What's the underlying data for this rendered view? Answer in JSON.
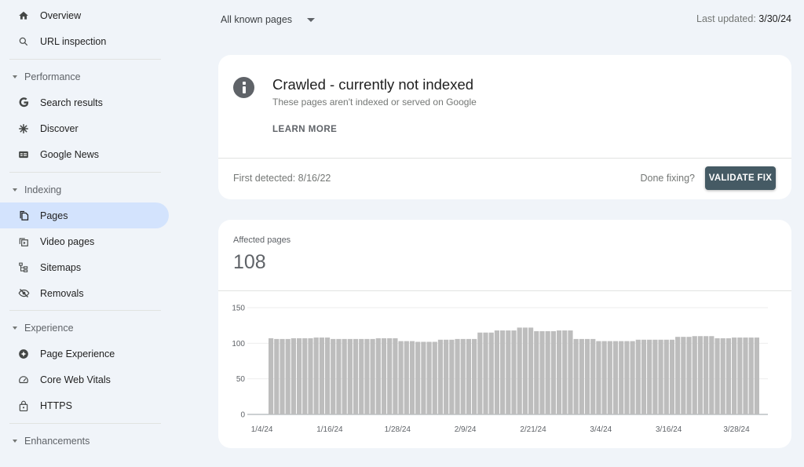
{
  "sidebar": {
    "top_items": [
      {
        "label": "Overview",
        "icon": "home-icon"
      },
      {
        "label": "URL inspection",
        "icon": "search-icon"
      }
    ],
    "sections": [
      {
        "title": "Performance",
        "items": [
          {
            "label": "Search results",
            "icon": "google-g-icon"
          },
          {
            "label": "Discover",
            "icon": "asterisk-icon"
          },
          {
            "label": "Google News",
            "icon": "news-icon"
          }
        ]
      },
      {
        "title": "Indexing",
        "items": [
          {
            "label": "Pages",
            "icon": "pages-icon",
            "active": true
          },
          {
            "label": "Video pages",
            "icon": "video-pages-icon"
          },
          {
            "label": "Sitemaps",
            "icon": "sitemap-icon"
          },
          {
            "label": "Removals",
            "icon": "eye-off-icon"
          }
        ]
      },
      {
        "title": "Experience",
        "items": [
          {
            "label": "Page Experience",
            "icon": "page-experience-icon"
          },
          {
            "label": "Core Web Vitals",
            "icon": "gauge-icon"
          },
          {
            "label": "HTTPS",
            "icon": "lock-icon"
          }
        ]
      },
      {
        "title": "Enhancements",
        "items": []
      }
    ]
  },
  "header": {
    "filter_value": "All known pages",
    "last_updated_label": "Last updated:",
    "last_updated_value": "3/30/24"
  },
  "issue": {
    "title": "Crawled - currently not indexed",
    "subtitle": "These pages aren't indexed or served on Google",
    "learn_more": "LEARN MORE",
    "first_detected": "First detected: 8/16/22",
    "done_fixing": "Done fixing?",
    "validate_label": "VALIDATE FIX",
    "icon_color": "#5f6368",
    "button_color": "#455a64"
  },
  "affected": {
    "label": "Affected pages",
    "value": "108"
  },
  "chart_data": {
    "type": "bar",
    "title": "",
    "xlabel": "",
    "ylabel": "",
    "ylim": [
      0,
      150
    ],
    "yticks": [
      0,
      50,
      100,
      150
    ],
    "grid": true,
    "bar_color": "#bdbdbd",
    "xtick_labels": [
      "1/4/24",
      "1/16/24",
      "1/28/24",
      "2/9/24",
      "2/21/24",
      "3/4/24",
      "3/16/24",
      "3/28/24"
    ],
    "start_date": "1/4/24",
    "end_date": "3/30/24",
    "values": [
      107,
      106,
      106,
      106,
      107,
      107,
      107,
      107,
      108,
      108,
      108,
      106,
      106,
      106,
      106,
      106,
      106,
      106,
      106,
      107,
      107,
      107,
      107,
      103,
      103,
      103,
      102,
      102,
      102,
      102,
      105,
      105,
      105,
      106,
      106,
      106,
      106,
      115,
      115,
      115,
      118,
      118,
      118,
      118,
      122,
      122,
      122,
      117,
      117,
      117,
      117,
      118,
      118,
      118,
      106,
      106,
      106,
      106,
      103,
      103,
      103,
      103,
      103,
      103,
      103,
      105,
      105,
      105,
      105,
      105,
      105,
      105,
      109,
      109,
      109,
      110,
      110,
      110,
      110,
      107,
      107,
      107,
      108,
      108,
      108,
      108,
      108
    ]
  }
}
